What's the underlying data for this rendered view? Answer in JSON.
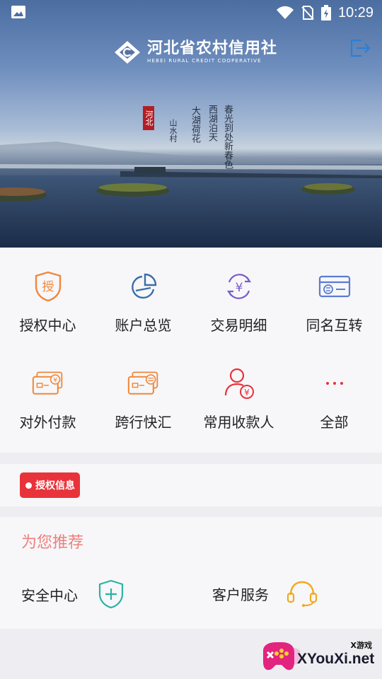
{
  "status_bar": {
    "time": "10:29"
  },
  "header": {
    "logo_cn": "河北省农村信用社",
    "logo_en": "HEBEI RURAL CREDIT COOPERATIVE"
  },
  "banner": {
    "calligraphy": [
      "春光到处新春色",
      "西湖泊天",
      "大湖荷花",
      "山水村"
    ],
    "seal": "河北"
  },
  "grid": {
    "items": [
      {
        "label": "授权中心",
        "icon": "authorize-shield-icon",
        "color": "#f0873b"
      },
      {
        "label": "账户总览",
        "icon": "pie-chart-icon",
        "color": "#3b6ea8"
      },
      {
        "label": "交易明细",
        "icon": "yuan-cycle-icon",
        "color": "#7a5ccc"
      },
      {
        "label": "同名互转",
        "icon": "card-transfer-icon",
        "color": "#5b7bd3"
      },
      {
        "label": "对外付款",
        "icon": "card-yuan-icon",
        "color": "#f0873b"
      },
      {
        "label": "跨行快汇",
        "icon": "card-exchange-icon",
        "color": "#f0873b"
      },
      {
        "label": "常用收款人",
        "icon": "payee-icon",
        "color": "#e8333a"
      },
      {
        "label": "全部",
        "icon": "more-dots-icon",
        "color": "#e8333a"
      }
    ]
  },
  "auth_info": {
    "tag": "授权信息"
  },
  "recommend": {
    "title": "为您推荐",
    "items": [
      {
        "label": "安全中心",
        "icon": "security-shield-icon",
        "color": "#2bb3a3"
      },
      {
        "label": "客户服务",
        "icon": "headset-icon",
        "color": "#f2a91e"
      }
    ]
  },
  "watermark": {
    "small": "X游戏",
    "big": "XYouXi.net"
  }
}
